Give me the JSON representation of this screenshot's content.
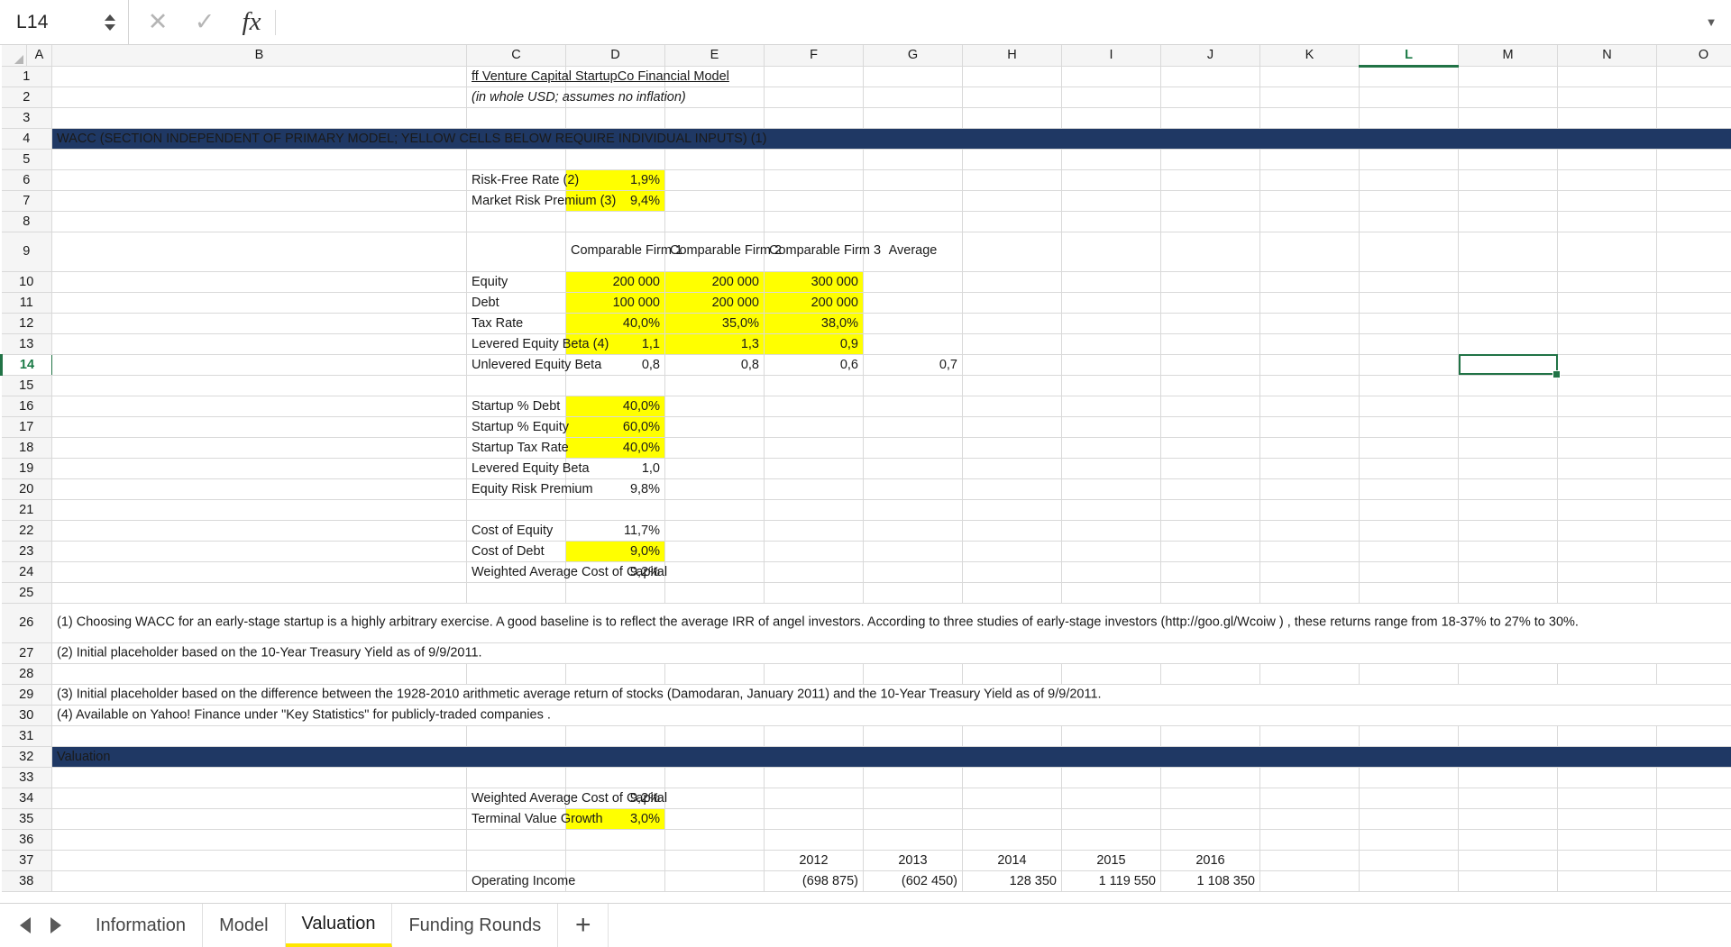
{
  "formula_bar": {
    "name_box_value": "L14",
    "formula_value": "",
    "cancel_icon": "✕",
    "confirm_icon": "✓",
    "fx_icon": "fx",
    "dropdown_icon": "▼"
  },
  "grid": {
    "selected_cell": "L14",
    "selected_column": "L",
    "selected_row": 14,
    "columns": [
      "A",
      "B",
      "C",
      "D",
      "E",
      "F",
      "G",
      "H",
      "I",
      "J",
      "K",
      "L",
      "M",
      "N",
      "O"
    ],
    "accent_navy": "#1f3864",
    "accent_yellow": "#ffff00",
    "accent_green": "#217346",
    "rows": [
      {
        "n": 1,
        "A": "",
        "B": "ff Venture Capital StartupCo Financial Model"
      },
      {
        "n": 2,
        "A": "",
        "B": "(in whole USD; assumes no inflation)"
      },
      {
        "n": 3,
        "A": "",
        "B": ""
      },
      {
        "n": 4,
        "A": "",
        "B": "WACC (SECTION INDEPENDENT OF PRIMARY MODEL; YELLOW CELLS BELOW REQUIRE INDIVIDUAL INPUTS) (1)"
      },
      {
        "n": 5,
        "A": "",
        "B": ""
      },
      {
        "n": 6,
        "A": "",
        "B": "Risk-Free Rate (2)",
        "C": "1,9%"
      },
      {
        "n": 7,
        "A": "",
        "B": "Market Risk Premium (3)",
        "C": "9,4%"
      },
      {
        "n": 8,
        "A": "",
        "B": ""
      },
      {
        "n": 9,
        "A": "",
        "B": "",
        "C": "Comparable\nFirm 1",
        "D": "Comparable\nFirm 2",
        "E": "Comparable\nFirm 3",
        "F": "Average"
      },
      {
        "n": 10,
        "A": "",
        "B": "Equity",
        "C": "200 000",
        "D": "200 000",
        "E": "300 000"
      },
      {
        "n": 11,
        "A": "",
        "B": "Debt",
        "C": "100 000",
        "D": "200 000",
        "E": "200 000"
      },
      {
        "n": 12,
        "A": "",
        "B": "Tax Rate",
        "C": "40,0%",
        "D": "35,0%",
        "E": "38,0%"
      },
      {
        "n": 13,
        "A": "",
        "B": "Levered Equity Beta (4)",
        "C": "1,1",
        "D": "1,3",
        "E": "0,9"
      },
      {
        "n": 14,
        "A": "",
        "B": "Unlevered Equity Beta",
        "C": "0,8",
        "D": "0,8",
        "E": "0,6",
        "F": "0,7"
      },
      {
        "n": 15,
        "A": "",
        "B": ""
      },
      {
        "n": 16,
        "A": "",
        "B": "Startup % Debt",
        "C": "40,0%"
      },
      {
        "n": 17,
        "A": "",
        "B": "Startup % Equity",
        "C": "60,0%"
      },
      {
        "n": 18,
        "A": "",
        "B": "Startup Tax Rate",
        "C": "40,0%"
      },
      {
        "n": 19,
        "A": "",
        "B": "Levered Equity Beta",
        "C": "1,0"
      },
      {
        "n": 20,
        "A": "",
        "B": "Equity Risk Premium",
        "C": "9,8%"
      },
      {
        "n": 21,
        "A": "",
        "B": ""
      },
      {
        "n": 22,
        "A": "",
        "B": "Cost of Equity",
        "C": "11,7%"
      },
      {
        "n": 23,
        "A": "",
        "B": "Cost of Debt",
        "C": "9,0%"
      },
      {
        "n": 24,
        "A": "",
        "B": "Weighted Average Cost of Capital",
        "C": "9,2%"
      },
      {
        "n": 25,
        "A": "",
        "B": ""
      },
      {
        "n": 26,
        "A": "",
        "B": "(1) Choosing WACC for an early-stage startup is a highly arbitrary exercise.  A good baseline is to reflect the average IRR of angel investors.  According to three studies of early-stage investors (http://goo.gl/Wcoiw ) , these returns range from 18-37% to 27% to 30%."
      },
      {
        "n": 27,
        "A": "",
        "B": "(2) Initial placeholder based on the 10-Year Treasury Yield as of 9/9/2011."
      },
      {
        "n": 28,
        "A": "",
        "B": ""
      },
      {
        "n": 29,
        "A": "",
        "B": "(3) Initial placeholder based on the difference between the 1928-2010 arithmetic average return of stocks (Damodaran, January 2011) and the 10-Year Treasury Yield as of 9/9/2011."
      },
      {
        "n": 30,
        "A": "",
        "B": "(4) Available on Yahoo! Finance under \"Key Statistics\" for publicly-traded companies ."
      },
      {
        "n": 31,
        "A": "",
        "B": ""
      },
      {
        "n": 32,
        "A": "",
        "B": "Valuation"
      },
      {
        "n": 33,
        "A": "",
        "B": ""
      },
      {
        "n": 34,
        "A": "",
        "B": "Weighted Average Cost of Capital",
        "C": "9,2%"
      },
      {
        "n": 35,
        "A": "",
        "B": "Terminal Value Growth",
        "C": "3,0%"
      },
      {
        "n": 36,
        "A": "",
        "B": ""
      },
      {
        "n": 37,
        "A": "",
        "B": "",
        "E": "2012",
        "F": "2013",
        "G": "2014",
        "H": "2015",
        "I": "2016"
      },
      {
        "n": 38,
        "A": "",
        "B": "Operating Income",
        "E": "(698 875)",
        "F": "(602 450)",
        "G": "128 350",
        "H": "1 119 550",
        "I": "1 108 350"
      }
    ]
  },
  "sheet_tabs": {
    "prev_icon": "◀",
    "next_icon": "▶",
    "add_icon": "+",
    "items": [
      {
        "label": "Information",
        "active": false
      },
      {
        "label": "Model",
        "active": false
      },
      {
        "label": "Valuation",
        "active": true
      },
      {
        "label": "Funding Rounds",
        "active": false
      }
    ]
  }
}
